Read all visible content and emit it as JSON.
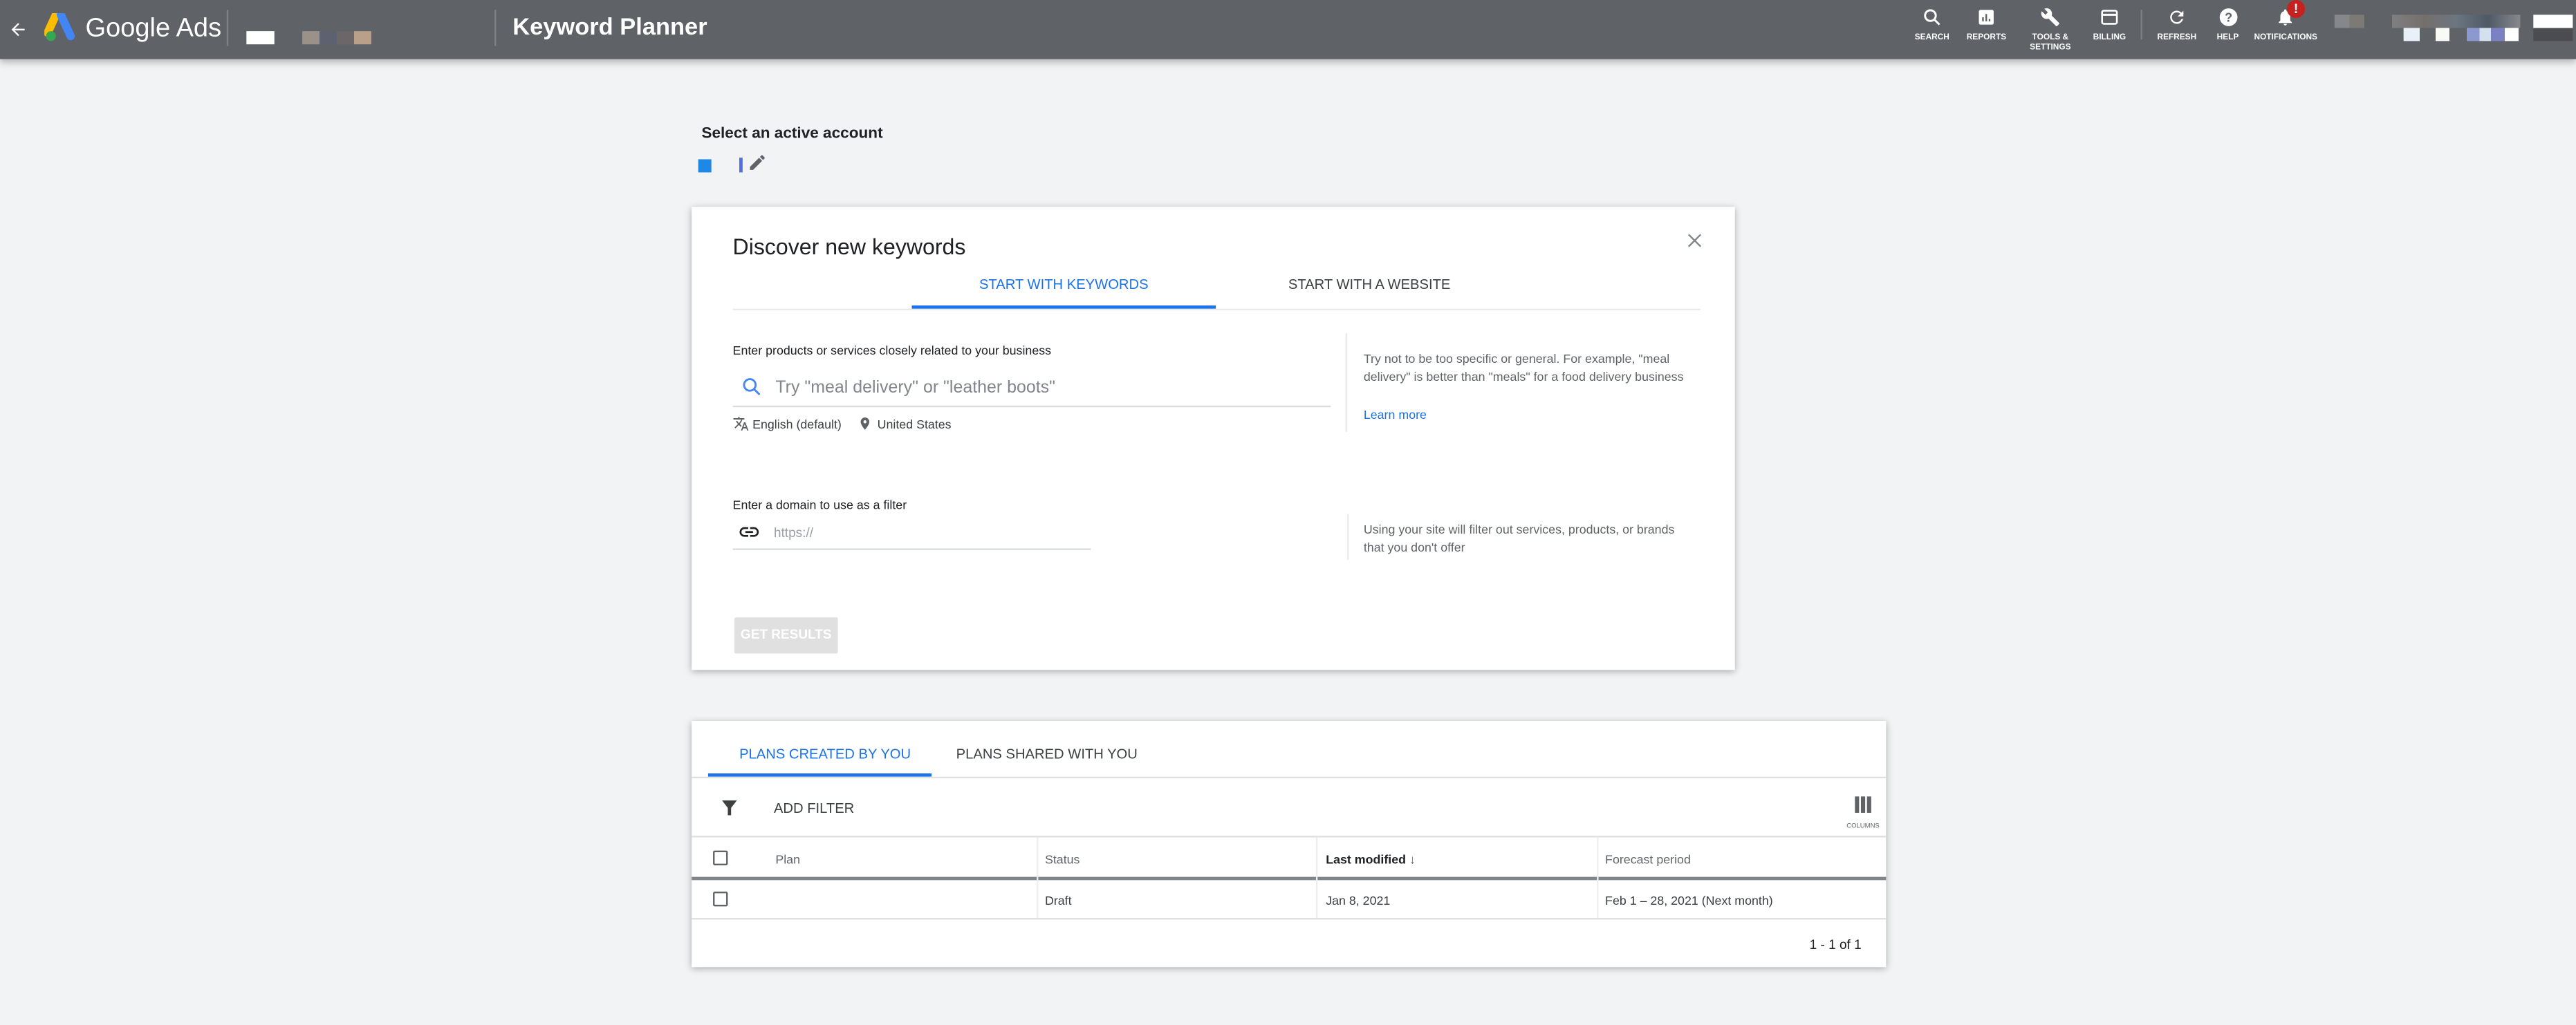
{
  "header": {
    "app_name": "Google Ads",
    "page_title": "Keyword Planner",
    "nav": [
      {
        "label": "SEARCH",
        "icon": "search-icon"
      },
      {
        "label": "REPORTS",
        "icon": "reports-icon"
      },
      {
        "label": "TOOLS &",
        "label2": "SETTINGS",
        "icon": "wrench-icon"
      },
      {
        "label": "BILLING",
        "icon": "billing-icon"
      },
      {
        "label": "REFRESH",
        "icon": "refresh-icon"
      },
      {
        "label": "HELP",
        "icon": "help-icon"
      },
      {
        "label": "NOTIFICATIONS",
        "icon": "bell-icon",
        "badge": "!"
      }
    ],
    "colors": {
      "bar": "#5f6368",
      "badge": "#c5221f"
    }
  },
  "account": {
    "label": "Select an active account"
  },
  "discover": {
    "title": "Discover new keywords",
    "tabs": [
      {
        "label": "START WITH KEYWORDS",
        "active": true
      },
      {
        "label": "START WITH A WEBSITE",
        "active": false
      }
    ],
    "keywords_label": "Enter products or services closely related to your business",
    "keywords_placeholder": "Try \"meal delivery\" or \"leather boots\"",
    "language": "English (default)",
    "location": "United States",
    "keywords_hint": "Try not to be too specific or general. For example, \"meal delivery\" is better than \"meals\" for a food delivery business",
    "learn_more": "Learn more",
    "domain_label": "Enter a domain to use as a filter",
    "domain_placeholder": "https://",
    "domain_hint": "Using your site will filter out services, products, or brands that you don't offer",
    "submit": "GET RESULTS"
  },
  "plans": {
    "tabs": [
      {
        "label": "PLANS CREATED BY YOU",
        "active": true
      },
      {
        "label": "PLANS SHARED WITH YOU",
        "active": false
      }
    ],
    "add_filter": "ADD FILTER",
    "columns_label": "COLUMNS",
    "headers": {
      "plan": "Plan",
      "status": "Status",
      "last_modified": "Last modified",
      "forecast": "Forecast period"
    },
    "rows": [
      {
        "plan": "",
        "status": "Draft",
        "last_modified": "Jan 8, 2021",
        "forecast": "Feb 1 – 28, 2021 (Next month)"
      }
    ],
    "pagination": "1 - 1 of 1"
  },
  "accent": "#1a73e8"
}
